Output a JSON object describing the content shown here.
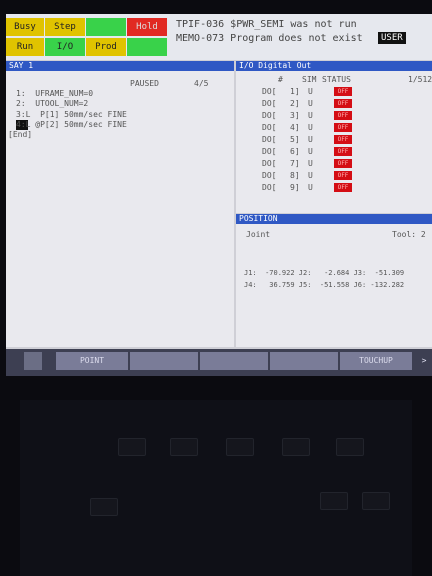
{
  "status_buttons": [
    {
      "label": "Busy",
      "color": "#e0c300"
    },
    {
      "label": "Step",
      "color": "#e0c300"
    },
    {
      "label": "",
      "color": "#39d24a"
    },
    {
      "label": "Hold",
      "color": "#e12a23"
    },
    {
      "label": "Run",
      "color": "#e0c300"
    },
    {
      "label": "I/O",
      "color": "#39d24a"
    },
    {
      "label": "Prod",
      "color": "#e0c300"
    },
    {
      "label": "",
      "color": "#39d24a"
    }
  ],
  "alarm_line_1": "TPIF-036 $PWR_SEMI was not run",
  "alarm_line_2": "MEMO-073 Program does not exist",
  "user_badge": "USER",
  "program": {
    "title": "SAY 1",
    "state": "PAUSED",
    "position": "4/5",
    "lines": [
      "1:  UFRAME_NUM=0",
      "2:  UTOOL_NUM=2",
      "3:L  P[1] 50mm/sec FINE",
      "4:L @P[2] 50mm/sec FINE",
      "[End]"
    ]
  },
  "io": {
    "title": "I/O Digital Out",
    "headers": {
      "num": "#",
      "sim": "SIM",
      "status": "STATUS",
      "page": "1/512"
    },
    "rows": [
      {
        "name": "DO[",
        "num": "1]",
        "sim": "U",
        "status": "OFF"
      },
      {
        "name": "DO[",
        "num": "2]",
        "sim": "U",
        "status": "OFF"
      },
      {
        "name": "DO[",
        "num": "3]",
        "sim": "U",
        "status": "OFF"
      },
      {
        "name": "DO[",
        "num": "4]",
        "sim": "U",
        "status": "OFF"
      },
      {
        "name": "DO[",
        "num": "5]",
        "sim": "U",
        "status": "OFF"
      },
      {
        "name": "DO[",
        "num": "6]",
        "sim": "U",
        "status": "OFF"
      },
      {
        "name": "DO[",
        "num": "7]",
        "sim": "U",
        "status": "OFF"
      },
      {
        "name": "DO[",
        "num": "8]",
        "sim": "U",
        "status": "OFF"
      },
      {
        "name": "DO[",
        "num": "9]",
        "sim": "U",
        "status": "OFF"
      }
    ]
  },
  "position": {
    "title": "POSITION",
    "mode": "Joint",
    "tool": "Tool: 2",
    "row1": "J1:  -70.922 J2:   -2.684 J3:  -51.309",
    "row2": "J4:   36.759 J5:  -51.558 J6: -132.282"
  },
  "function_keys": [
    "",
    "POINT",
    "",
    "",
    "",
    "TOUCHUP"
  ],
  "next_arrow": ">"
}
